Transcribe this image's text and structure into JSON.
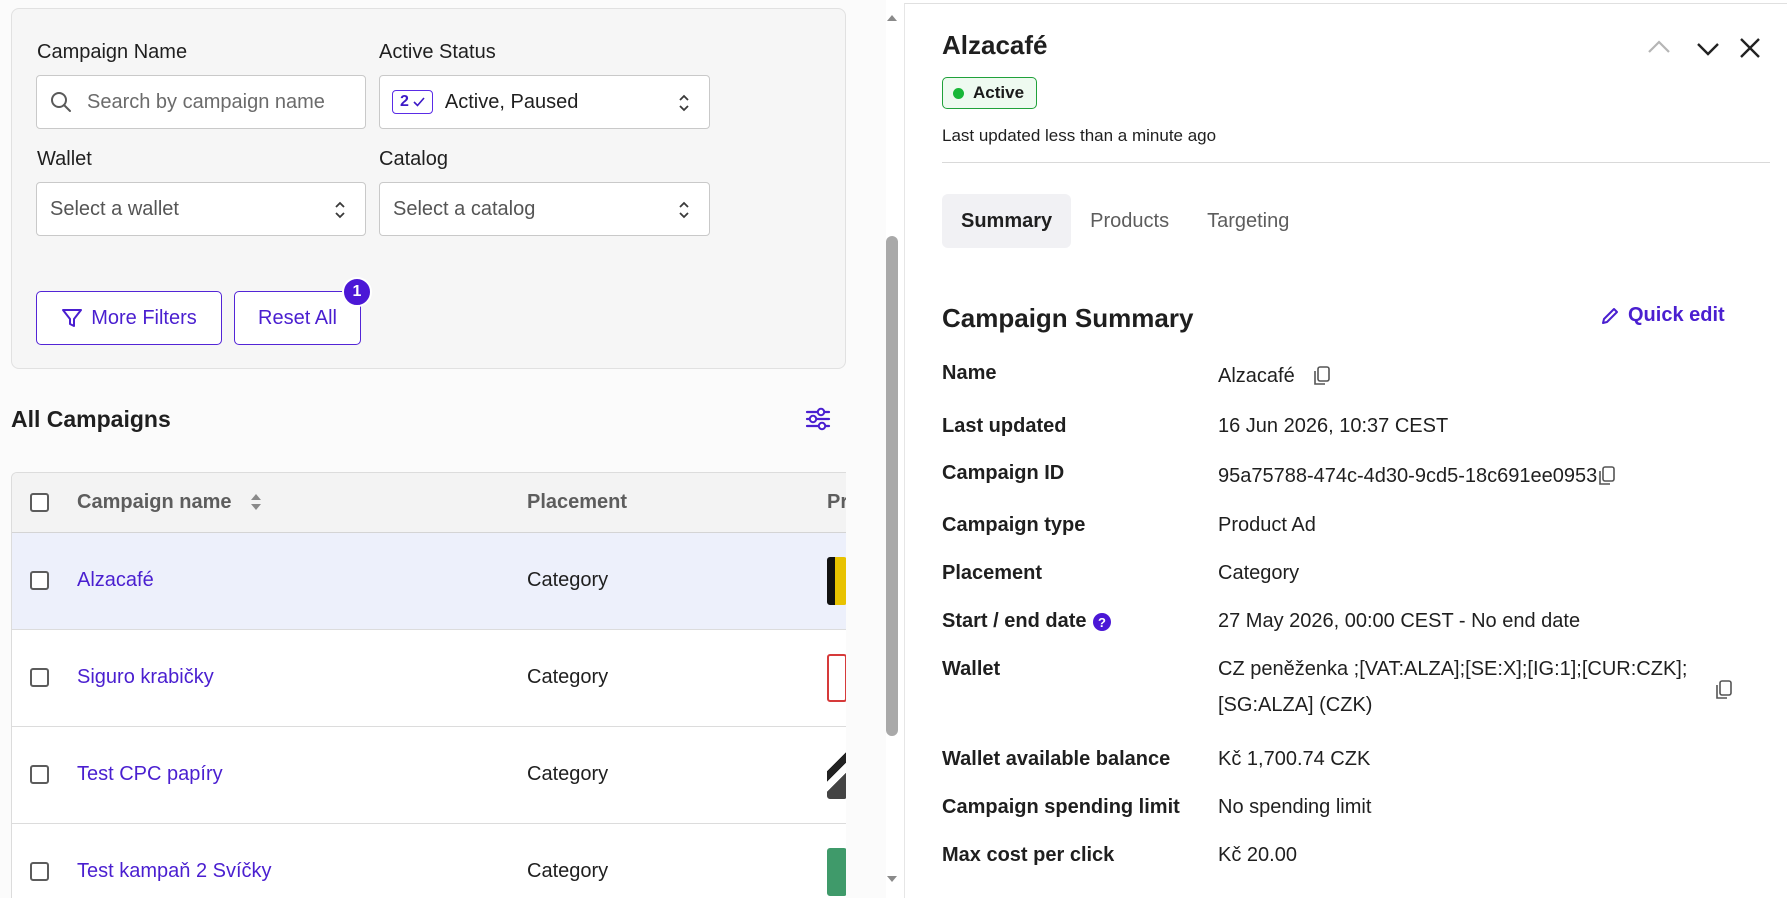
{
  "filters": {
    "campaign_name_label": "Campaign Name",
    "campaign_name_placeholder": "Search by campaign name",
    "active_status_label": "Active Status",
    "active_status_count": "2",
    "active_status_value": "Active, Paused",
    "wallet_label": "Wallet",
    "wallet_placeholder": "Select a wallet",
    "catalog_label": "Catalog",
    "catalog_placeholder": "Select a catalog",
    "more_filters_label": "More Filters",
    "reset_all_label": "Reset All",
    "reset_badge": "1"
  },
  "campaigns": {
    "title": "All Campaigns",
    "columns": [
      "Campaign name",
      "Placement",
      "Pr"
    ],
    "rows": [
      {
        "name": "Alzacafé",
        "placement": "Category",
        "selected": true
      },
      {
        "name": "Siguro krabičky",
        "placement": "Category",
        "selected": false
      },
      {
        "name": "Test CPC papíry",
        "placement": "Category",
        "selected": false
      },
      {
        "name": "Test kampaň 2 Svíčky",
        "placement": "Category",
        "selected": false
      }
    ]
  },
  "detail": {
    "title": "Alzacafé",
    "status": "Active",
    "last_updated_note": "Last updated less than a minute ago",
    "tabs": [
      "Summary",
      "Products",
      "Targeting"
    ],
    "active_tab": "Summary",
    "summary_title": "Campaign Summary",
    "quick_edit_label": "Quick edit",
    "fields": {
      "name_k": "Name",
      "name_v": "Alzacafé",
      "last_updated_k": "Last updated",
      "last_updated_v": "16 Jun 2026, 10:37 CEST",
      "campaign_id_k": "Campaign ID",
      "campaign_id_v": "95a75788-474c-4d30-9cd5-18c691ee0953",
      "campaign_type_k": "Campaign type",
      "campaign_type_v": "Product Ad",
      "placement_k": "Placement",
      "placement_v": "Category",
      "dates_k": "Start / end date",
      "dates_v": "27 May 2026, 00:00 CEST - No end date",
      "wallet_k": "Wallet",
      "wallet_v1": "CZ peněženka ;[VAT:ALZA];[SE:X];[IG:1];[CUR:CZK];",
      "wallet_v2": "[SG:ALZA] (CZK)",
      "balance_k": "Wallet available balance",
      "balance_v": "Kč 1,700.74 CZK",
      "spend_limit_k": "Campaign spending limit",
      "spend_limit_v": "No spending limit",
      "max_cpc_k": "Max cost per click",
      "max_cpc_v": "Kč 20.00"
    }
  },
  "colors": {
    "accent": "#4a1fd0",
    "status_green": "#18b738"
  },
  "icons": [
    "search-icon",
    "sort-icon",
    "filter-icon",
    "sliders-icon",
    "chevron-up-icon",
    "chevron-down-icon",
    "close-icon",
    "pencil-icon",
    "copy-icon",
    "help-icon"
  ]
}
